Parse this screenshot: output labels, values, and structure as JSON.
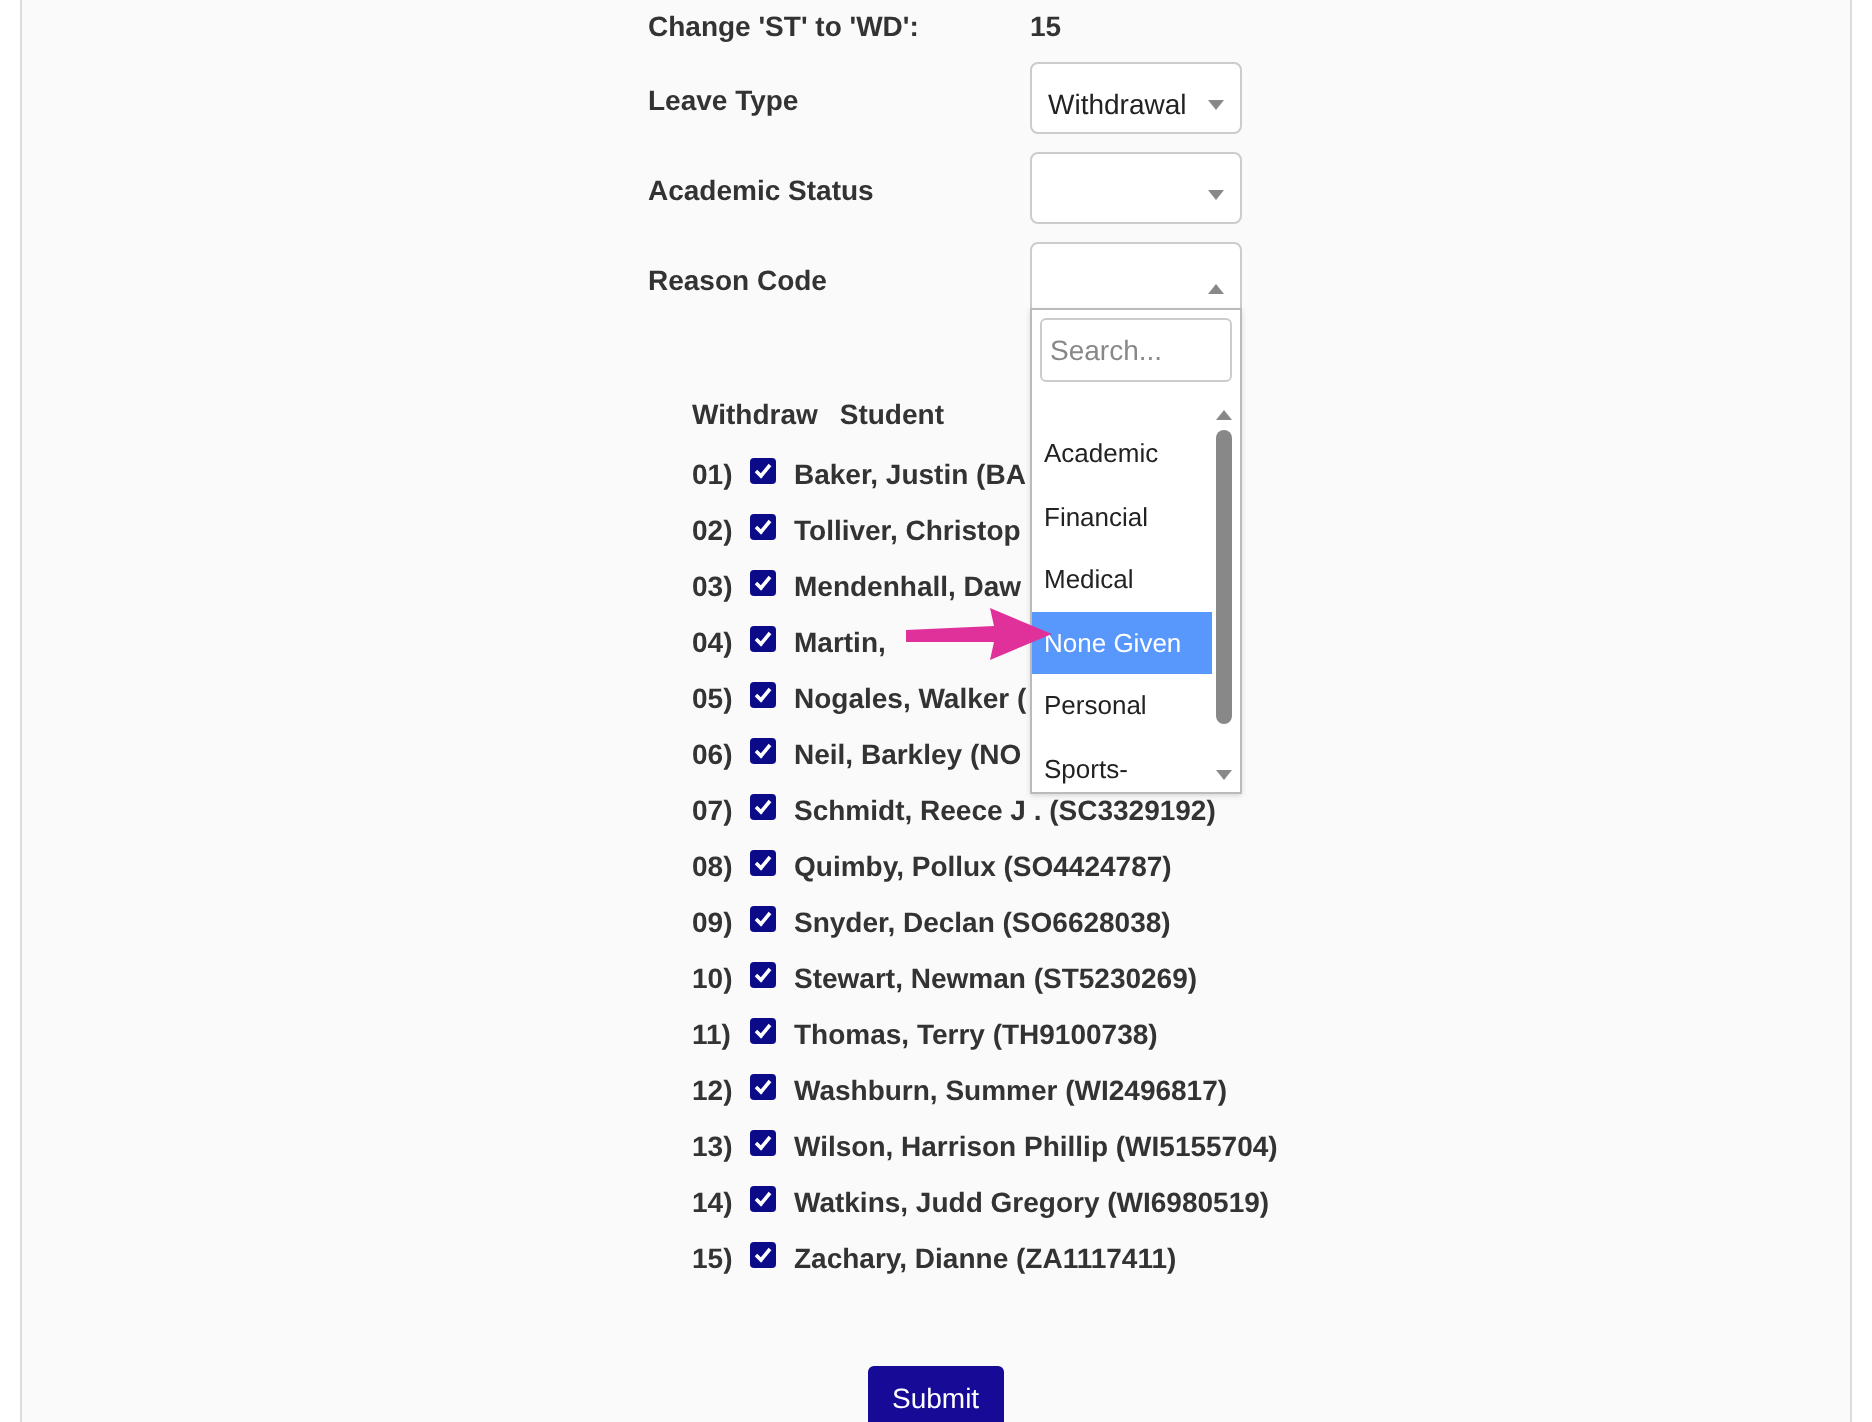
{
  "summary": {
    "label": "Change 'ST' to 'WD':",
    "value": "15"
  },
  "fields": [
    {
      "label": "Leave Type",
      "value": "Withdrawal",
      "expanded": false
    },
    {
      "label": "Academic Status",
      "expanded": false
    },
    {
      "label": "Reason Code",
      "expanded": true
    }
  ],
  "dropdown": {
    "search_placeholder": "Search...",
    "options": [
      {
        "label": "Academic",
        "selected": false
      },
      {
        "label": "Financial",
        "selected": false
      },
      {
        "label": "Medical",
        "selected": false
      },
      {
        "label": "None Given",
        "selected": true
      },
      {
        "label": "Personal",
        "selected": false
      },
      {
        "label": "Sports-",
        "selected": false
      }
    ]
  },
  "table": {
    "columns": [
      "Withdraw",
      "Student"
    ],
    "rows": [
      {
        "number": "01)",
        "checked": true,
        "student": "Baker, Justin (BA"
      },
      {
        "number": "02)",
        "checked": true,
        "student": "Tolliver, Christop"
      },
      {
        "number": "03)",
        "checked": true,
        "student": "Mendenhall, Daw"
      },
      {
        "number": "04)",
        "checked": true,
        "student": "Martin,"
      },
      {
        "number": "05)",
        "checked": true,
        "student": "Nogales, Walker ("
      },
      {
        "number": "06)",
        "checked": true,
        "student": "Neil, Barkley (NO"
      },
      {
        "number": "07)",
        "checked": true,
        "student": "Schmidt, Reece  J . (SC3329192)"
      },
      {
        "number": "08)",
        "checked": true,
        "student": "Quimby, Pollux (SO4424787)"
      },
      {
        "number": "09)",
        "checked": true,
        "student": "Snyder, Declan (SO6628038)"
      },
      {
        "number": "10)",
        "checked": true,
        "student": "Stewart, Newman (ST5230269)"
      },
      {
        "number": "11)",
        "checked": true,
        "student": "Thomas, Terry (TH9100738)"
      },
      {
        "number": "12)",
        "checked": true,
        "student": "Washburn, Summer (WI2496817)"
      },
      {
        "number": "13)",
        "checked": true,
        "student": "Wilson, Harrison  Phillip (WI5155704)"
      },
      {
        "number": "14)",
        "checked": true,
        "student": "Watkins, Judd  Gregory (WI6980519)"
      },
      {
        "number": "15)",
        "checked": true,
        "student": "Zachary, Dianne (ZA1117411)"
      }
    ]
  },
  "submit": "Submit"
}
